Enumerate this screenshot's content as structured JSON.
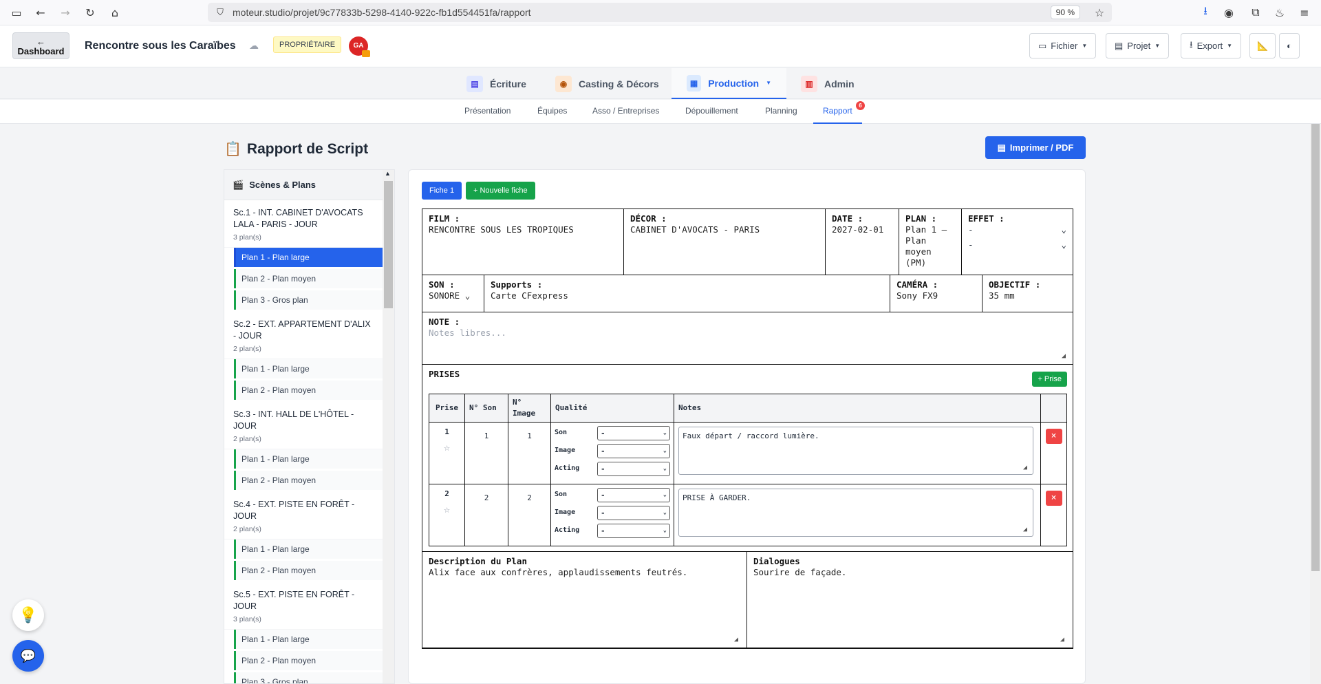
{
  "browser": {
    "url": "moteur.studio/projet/9c77833b-5298-4140-922c-fb1d554451fa/rapport",
    "zoom": "90 %"
  },
  "header": {
    "dashboard_label": "Dashboard",
    "project_title": "Rencontre sous les Caraïbes",
    "owner_badge": "PROPRIÉTAIRE",
    "avatar_initials": "GA",
    "fichier_label": "Fichier",
    "projet_label": "Projet",
    "export_label": "Export"
  },
  "topnav": {
    "items": [
      {
        "label": "Écriture",
        "icon": "document-icon"
      },
      {
        "label": "Casting & Décors",
        "icon": "eye-icon"
      },
      {
        "label": "Production",
        "icon": "clapper-icon"
      },
      {
        "label": "Admin",
        "icon": "chart-icon"
      }
    ],
    "active": "Production"
  },
  "subnav": {
    "items": [
      "Présentation",
      "Équipes",
      "Asso / Entreprises",
      "Dépouillement",
      "Planning",
      "Rapport"
    ],
    "active": "Rapport",
    "notif_count": "6"
  },
  "page": {
    "title": "Rapport de Script",
    "print_label": "Imprimer / PDF"
  },
  "sidebar": {
    "title": "Scènes & Plans",
    "scenes": [
      {
        "title": "Sc.1 - INT. CABINET D'AVOCATS LALA - PARIS - JOUR",
        "count": "3 plan(s)",
        "plans": [
          "Plan 1 - Plan large",
          "Plan 2 - Plan moyen",
          "Plan 3 - Gros plan"
        ]
      },
      {
        "title": "Sc.2 - EXT. APPARTEMENT D'ALIX - JOUR",
        "count": "2 plan(s)",
        "plans": [
          "Plan 1 - Plan large",
          "Plan 2 - Plan moyen"
        ]
      },
      {
        "title": "Sc.3 - INT. HALL DE L'HÔTEL - JOUR",
        "count": "2 plan(s)",
        "plans": [
          "Plan 1 - Plan large",
          "Plan 2 - Plan moyen"
        ]
      },
      {
        "title": "Sc.4 - EXT. PISTE EN FORÊT - JOUR",
        "count": "2 plan(s)",
        "plans": [
          "Plan 1 - Plan large",
          "Plan 2 - Plan moyen"
        ]
      },
      {
        "title": "Sc.5 - EXT. PISTE EN FORÊT - JOUR",
        "count": "3 plan(s)",
        "plans": [
          "Plan 1 - Plan large",
          "Plan 2 - Plan moyen",
          "Plan 3 - Gros plan"
        ]
      }
    ],
    "selected": "Sc.1 Plan 1"
  },
  "sheet": {
    "fiche_tab": "Fiche 1",
    "new_fiche_label": "+ Nouvelle fiche",
    "film_label": "FILM :",
    "film_value": "RENCONTRE SOUS LES TROPIQUES",
    "decor_label": "DÉCOR :",
    "decor_value": "CABINET D'AVOCATS - PARIS",
    "date_label": "DATE :",
    "date_value": "2027-02-01",
    "plan_label": "PLAN :",
    "plan_value": "Plan 1 — Plan moyen (PM)",
    "effet_label": "EFFET :",
    "effet_value1": "-",
    "effet_value2": "-",
    "son_label": "SON :",
    "son_value": "SONORE",
    "supports_label": "Supports :",
    "supports_value": "Carte CFexpress",
    "camera_label": "CAMÉRA :",
    "camera_value": "Sony FX9",
    "objectif_label": "OBJECTIF :",
    "objectif_value": "35 mm",
    "note_label": "NOTE :",
    "note_placeholder": "Notes libres...",
    "prises_label": "PRISES",
    "add_prise_label": "+ Prise",
    "table_headers": {
      "prise": "Prise",
      "son": "N° Son",
      "image": "N° Image",
      "qualite": "Qualité",
      "notes": "Notes"
    },
    "quality_labels": {
      "son": "Son",
      "image": "Image",
      "acting": "Acting"
    },
    "quality_default": "-",
    "prises": [
      {
        "num": "1",
        "son": "1",
        "image": "1",
        "notes": "Faux départ / raccord lumière."
      },
      {
        "num": "2",
        "son": "2",
        "image": "2",
        "notes": "PRISE À GARDER."
      }
    ],
    "description_label": "Description du Plan",
    "description_value": "Alix face aux confrères, applaudissements feutrés.",
    "dialogues_label": "Dialogues",
    "dialogues_value": "Sourire de façade."
  }
}
